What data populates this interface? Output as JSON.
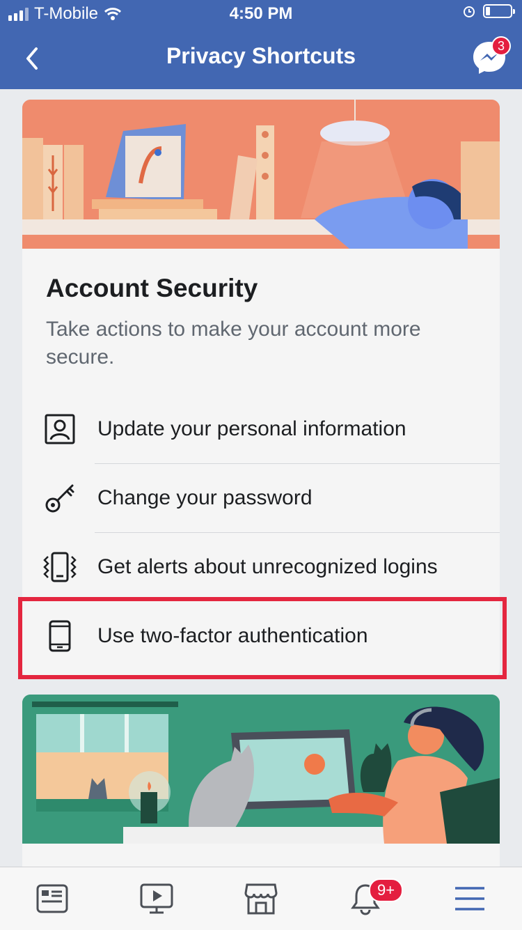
{
  "status_bar": {
    "carrier": "T-Mobile",
    "time": "4:50 PM"
  },
  "nav": {
    "title": "Privacy Shortcuts",
    "messenger_badge": "3",
    "back_icon": "chevron-left-icon",
    "messenger_icon": "messenger-icon"
  },
  "section": {
    "heading": "Account Security",
    "subtitle": "Take actions to make your account more secure.",
    "items": [
      {
        "label": "Update your personal information",
        "icon": "person-card-icon"
      },
      {
        "label": "Change your password",
        "icon": "key-icon"
      },
      {
        "label": "Get alerts about unrecognized logins",
        "icon": "vibrating-phone-icon"
      },
      {
        "label": "Use two-factor authentication",
        "icon": "phone-icon"
      }
    ]
  },
  "tabbar": {
    "items": [
      {
        "icon": "news-feed-icon"
      },
      {
        "icon": "watch-video-icon"
      },
      {
        "icon": "marketplace-icon"
      },
      {
        "icon": "notifications-bell-icon",
        "badge": "9+"
      },
      {
        "icon": "menu-icon",
        "active": true
      }
    ]
  },
  "colors": {
    "nav_blue": "#4267b2",
    "highlight_red": "#e4263f",
    "active_tab_blue": "#4267b2"
  }
}
